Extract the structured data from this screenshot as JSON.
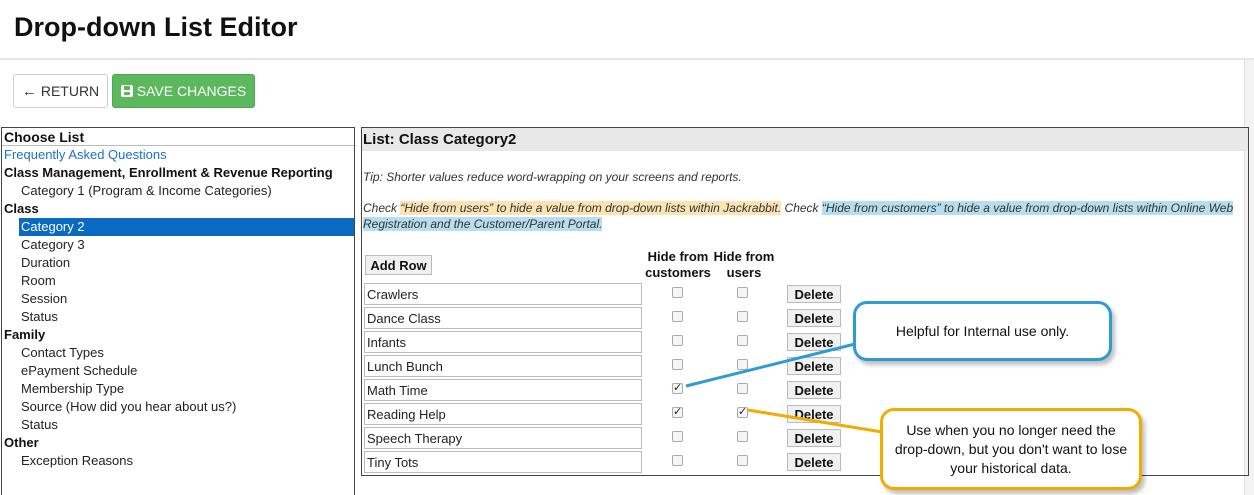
{
  "page": {
    "title": "Drop-down List Editor"
  },
  "toolbar": {
    "return_label": "RETURN",
    "save_label": "SAVE CHANGES"
  },
  "list_panel": {
    "header": "Choose List",
    "rows": [
      {
        "type": "link",
        "label": "Frequently Asked Questions"
      },
      {
        "type": "group",
        "label": "Class Management, Enrollment & Revenue Reporting"
      },
      {
        "type": "item",
        "label": "Category 1 (Program & Income Categories)"
      },
      {
        "type": "group",
        "label": "Class"
      },
      {
        "type": "item",
        "label": "Category 2",
        "selected": true
      },
      {
        "type": "item",
        "label": "Category 3"
      },
      {
        "type": "item",
        "label": "Duration"
      },
      {
        "type": "item",
        "label": "Room"
      },
      {
        "type": "item",
        "label": "Session"
      },
      {
        "type": "item",
        "label": "Status"
      },
      {
        "type": "group",
        "label": "Family"
      },
      {
        "type": "item",
        "label": "Contact Types"
      },
      {
        "type": "item",
        "label": "ePayment Schedule"
      },
      {
        "type": "item",
        "label": "Membership Type"
      },
      {
        "type": "item",
        "label": "Source (How did you hear about us?)"
      },
      {
        "type": "item",
        "label": "Status"
      },
      {
        "type": "group",
        "label": "Other"
      },
      {
        "type": "item",
        "label": "Exception Reasons"
      }
    ]
  },
  "editor": {
    "title": "List: Class Category2",
    "tip": "Tip: Shorter values reduce word-wrapping on your screens and reports.",
    "check_prefix": "Check ",
    "check_users_text": "“Hide from users” to hide a value from drop-down lists within Jackrabbit.",
    "check_middle": " Check ",
    "check_customers_text": "“Hide from customers” to hide a value from drop-down lists within Online Web Registration and the Customer/Parent Portal.",
    "add_row_label": "Add Row",
    "col_customers": "Hide from customers",
    "col_users": "Hide from users",
    "delete_label": "Delete",
    "rows": [
      {
        "value": "Crawlers",
        "hide_customers": false,
        "hide_users": false
      },
      {
        "value": "Dance Class",
        "hide_customers": false,
        "hide_users": false
      },
      {
        "value": "Infants",
        "hide_customers": false,
        "hide_users": false
      },
      {
        "value": "Lunch Bunch",
        "hide_customers": false,
        "hide_users": false
      },
      {
        "value": "Math Time",
        "hide_customers": true,
        "hide_users": false
      },
      {
        "value": "Reading Help",
        "hide_customers": true,
        "hide_users": true
      },
      {
        "value": "Speech Therapy",
        "hide_customers": false,
        "hide_users": false
      },
      {
        "value": "Tiny Tots",
        "hide_customers": false,
        "hide_users": false
      }
    ]
  },
  "callouts": {
    "internal": "Helpful for Internal use only.",
    "historical": "Use when you no longer need the drop-down, but you don't want to lose your historical data."
  },
  "colors": {
    "accent_blue": "#0a6ac2",
    "save_green": "#5cb85c",
    "highlight_orange": "#fce3b4",
    "highlight_blue": "#b7def0",
    "callout_blue": "#2f9ad6",
    "callout_yellow": "#f0ad00"
  }
}
